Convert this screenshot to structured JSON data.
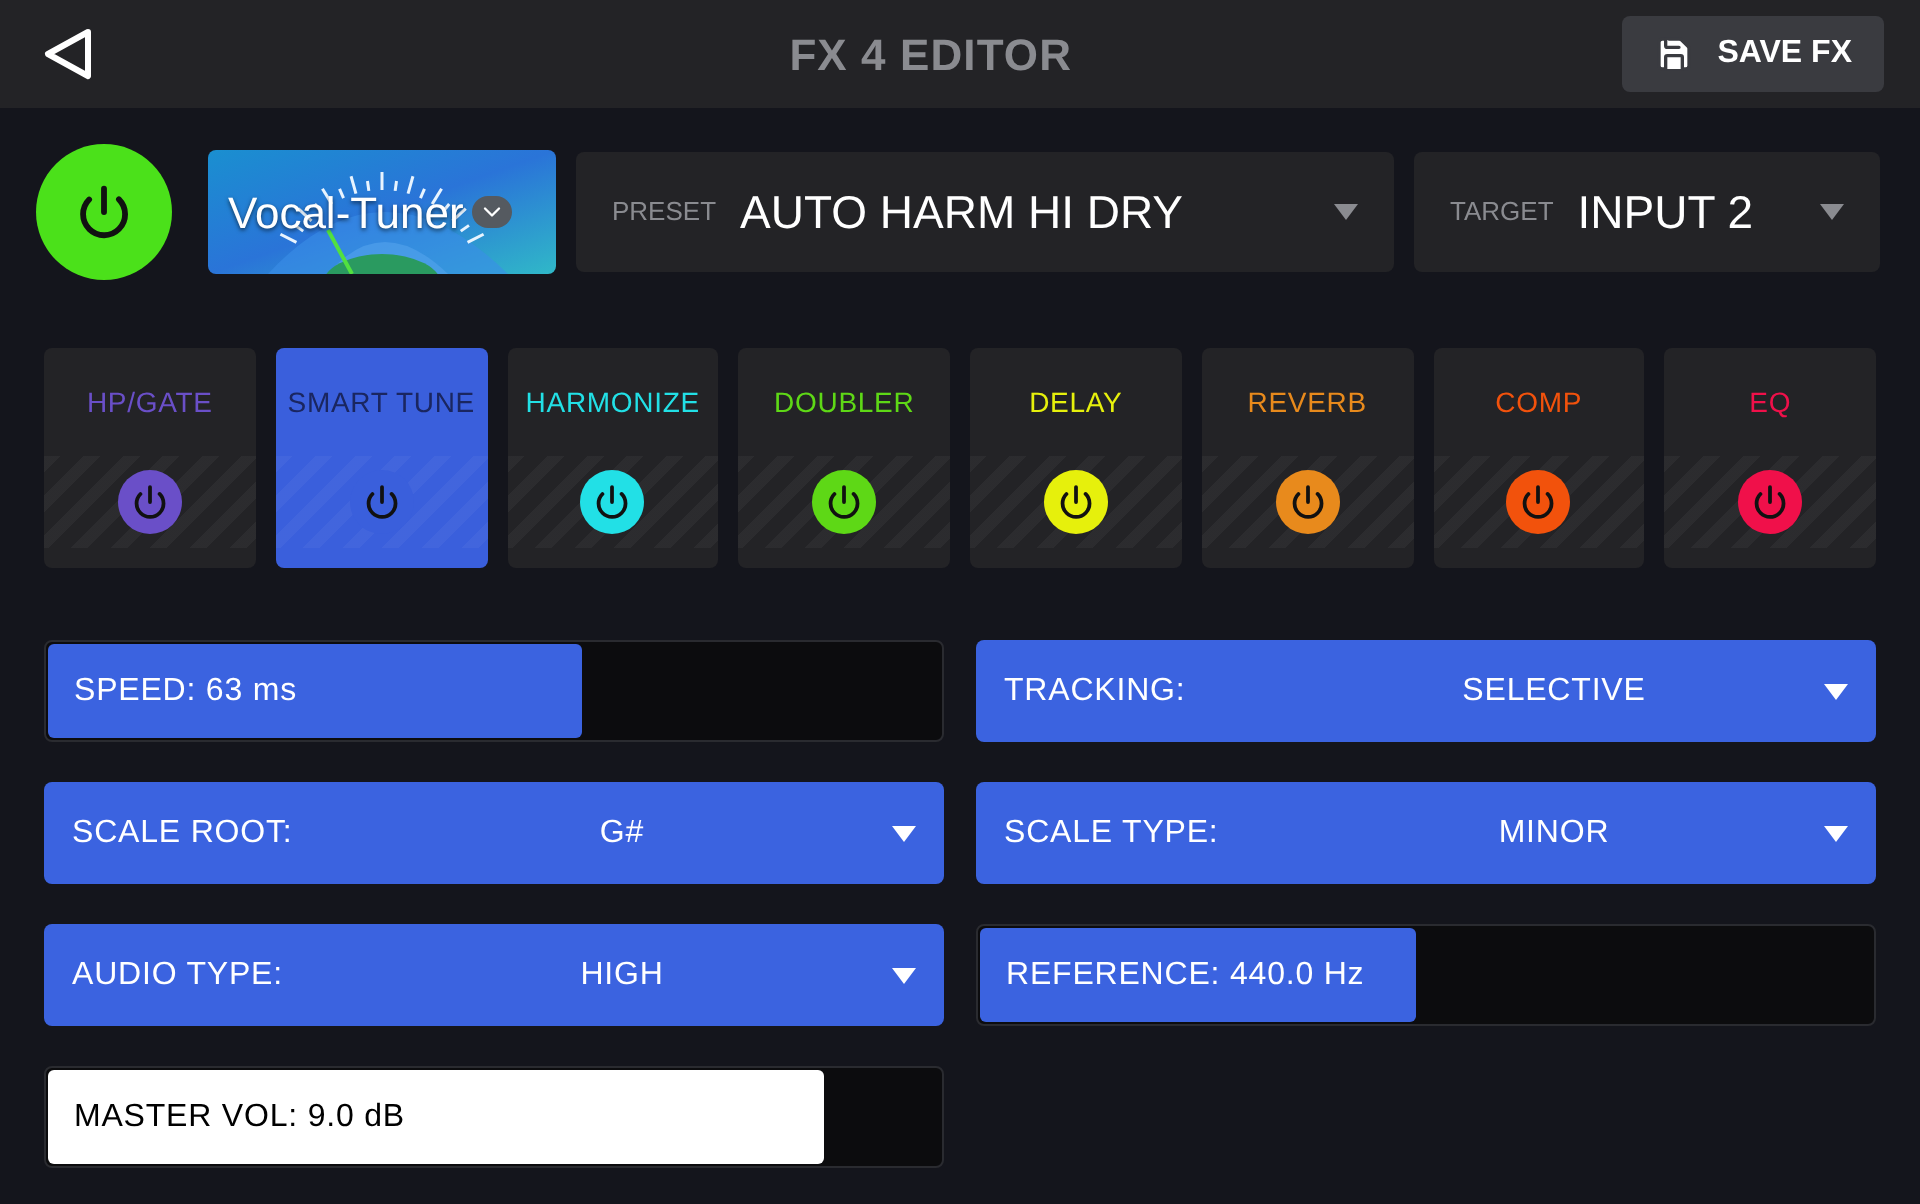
{
  "header": {
    "title": "FX 4 EDITOR",
    "save_button": "SAVE FX"
  },
  "effect": {
    "on": true,
    "name": "Vocal-Tuner",
    "preset_label": "PRESET",
    "preset": "AUTO HARM HI DRY",
    "target_label": "TARGET",
    "target": "INPUT 2"
  },
  "blocks": [
    {
      "label": "HP/GATE",
      "color": "#6a4fc8",
      "selected": false
    },
    {
      "label": "SMART TUNE",
      "color": "#3a5fdc",
      "selected": true
    },
    {
      "label": "HARMONIZE",
      "color": "#22e0e6",
      "selected": false
    },
    {
      "label": "DOUBLER",
      "color": "#5ed816",
      "selected": false
    },
    {
      "label": "DELAY",
      "color": "#e6f00c",
      "selected": false
    },
    {
      "label": "REVERB",
      "color": "#e88a1c",
      "selected": false
    },
    {
      "label": "COMP",
      "color": "#f2520c",
      "selected": false
    },
    {
      "label": "EQ",
      "color": "#f0104a",
      "selected": false
    }
  ],
  "params": [
    {
      "kind": "slider",
      "label": "SPEED: 63 ms",
      "level": 0.6,
      "color": "#3b63e0"
    },
    {
      "kind": "dropdown",
      "label": "TRACKING:",
      "value": "SELECTIVE"
    },
    {
      "kind": "dropdown",
      "label": "SCALE ROOT:",
      "value": "G#"
    },
    {
      "kind": "dropdown",
      "label": "SCALE TYPE:",
      "value": "MINOR"
    },
    {
      "kind": "dropdown",
      "label": "AUDIO TYPE:",
      "value": "HIGH"
    },
    {
      "kind": "slider",
      "label": "REFERENCE: 440.0 Hz",
      "level": 0.49,
      "color": "#3b63e0"
    },
    {
      "kind": "slider",
      "label": "MASTER VOL: 9.0 dB",
      "level": 0.87,
      "color": "#ffffff"
    }
  ]
}
